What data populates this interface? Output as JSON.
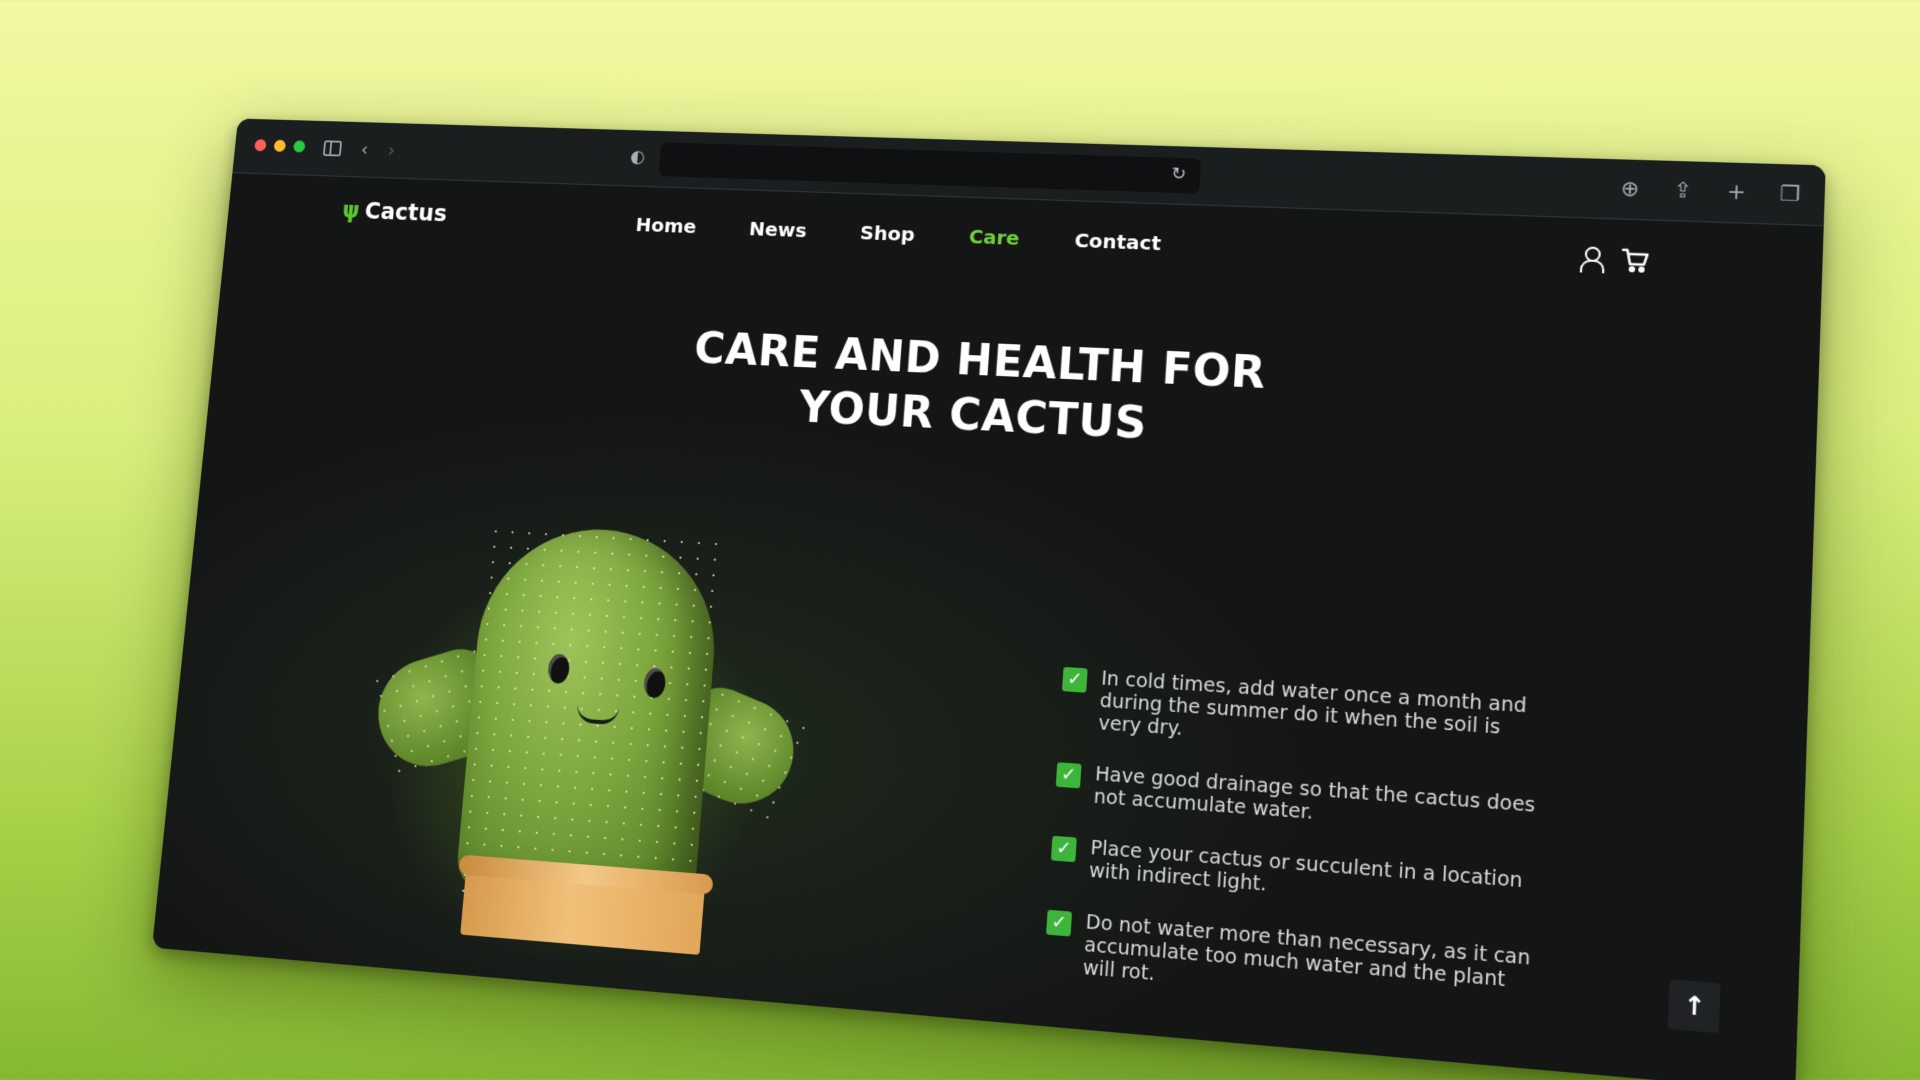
{
  "browser": {
    "icons": {
      "shield": "shield-icon",
      "reload": "reload-icon",
      "download": "download-icon",
      "share": "share-icon",
      "new_tab": "plus-icon",
      "tabs": "tabs-overview-icon"
    },
    "url": ""
  },
  "site": {
    "logo": {
      "text": "Cactus",
      "icon": "cactus-icon",
      "accent": "#5fc72d"
    },
    "nav": [
      {
        "label": "Home",
        "active": false
      },
      {
        "label": "News",
        "active": false
      },
      {
        "label": "Shop",
        "active": false
      },
      {
        "label": "Care",
        "active": true
      },
      {
        "label": "Contact",
        "active": false
      }
    ],
    "nav_icons": [
      "user-icon",
      "cart-icon"
    ],
    "headline": {
      "line1": "CARE AND HEALTH FOR",
      "line2": "YOUR CACTUS"
    },
    "tips": [
      "In cold times, add water once a month and during the summer do it when the soil is very dry.",
      "Have good drainage so that the cactus does not accumulate water.",
      "Place your cactus or succulent in a location with indirect light.",
      "Do not water more than necessary, as it can accumulate too much water and the plant will rot."
    ],
    "scroll_top_icon": "arrow-up-icon",
    "colors": {
      "active_nav": "#6fd13a",
      "check": "#3fb43a",
      "background": "#141616"
    }
  }
}
